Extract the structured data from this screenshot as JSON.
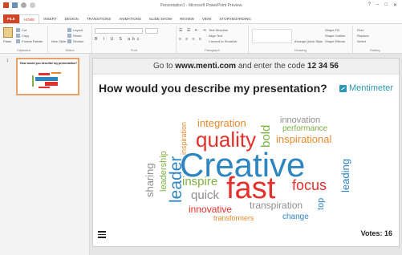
{
  "window": {
    "title": "Presentation1 - Microsoft PowerPoint Preview"
  },
  "tabs": [
    "FILE",
    "HOME",
    "INSERT",
    "DESIGN",
    "TRANSITIONS",
    "ANIMATIONS",
    "SLIDE SHOW",
    "REVIEW",
    "VIEW",
    "STORYBOARDING"
  ],
  "active_tab_index": 1,
  "ribbon": {
    "groups": [
      "Clipboard",
      "Slides",
      "Font",
      "Paragraph",
      "Drawing",
      "Editing"
    ],
    "clipboard": {
      "paste": "Paste",
      "cut": "Cut",
      "copy": "Copy",
      "format_painter": "Format Painter"
    },
    "slides": {
      "new_slide": "New Slide",
      "layout": "Layout",
      "reset": "Reset",
      "section": "Section"
    },
    "drawing": {
      "arrange": "Arrange",
      "quick_styles": "Quick Styles",
      "shape_fill": "Shape Fill",
      "shape_outline": "Shape Outline",
      "shape_effects": "Shape Effects"
    },
    "editing": {
      "find": "Find",
      "replace": "Replace",
      "select": "Select"
    },
    "paragraph": {
      "text_direction": "Text Direction",
      "align_text": "Align Text",
      "smartart": "Convert to SmartArt"
    }
  },
  "thumbnail": {
    "number": "1",
    "title": "How would you describe my presentation?"
  },
  "slide": {
    "header_prefix": "Go to",
    "header_site": "www.menti.com",
    "header_mid": "and enter the code",
    "header_code": "12 34 56",
    "question": "How would you describe my presentation?",
    "brand": "Mentimeter",
    "votes": "Votes: 16"
  },
  "colors": {
    "file_tab": "#d04525",
    "brand": "#2b97b4",
    "word_blue": "#2e86c1",
    "word_red": "#e5302c",
    "word_orange": "#e8892b",
    "word_green": "#7cb342",
    "word_gray": "#8f8f8f",
    "word_dark_gray": "#666666"
  },
  "word_cloud": [
    {
      "text": "Creative",
      "color": "#2e86c1"
    },
    {
      "text": "fast",
      "color": "#e5302c"
    },
    {
      "text": "quality",
      "color": "#e5302c"
    },
    {
      "text": "focus",
      "color": "#e5302c"
    },
    {
      "text": "leader",
      "color": "#2e86c1"
    },
    {
      "text": "integration",
      "color": "#e8892b"
    },
    {
      "text": "innovation",
      "color": "#8f8f8f"
    },
    {
      "text": "performance",
      "color": "#7cb342"
    },
    {
      "text": "inspirational",
      "color": "#e8892b"
    },
    {
      "text": "bold",
      "color": "#7cb342"
    },
    {
      "text": "inspiration",
      "color": "#e8892b"
    },
    {
      "text": "leadership",
      "color": "#7cb342"
    },
    {
      "text": "sharing",
      "color": "#8f8f8f"
    },
    {
      "text": "inspire",
      "color": "#7cb342"
    },
    {
      "text": "quick",
      "color": "#8f8f8f"
    },
    {
      "text": "innovative",
      "color": "#e5302c"
    },
    {
      "text": "transpiration",
      "color": "#8f8f8f"
    },
    {
      "text": "transformers",
      "color": "#e8892b"
    },
    {
      "text": "change",
      "color": "#2e86c1"
    },
    {
      "text": "top",
      "color": "#2e86c1"
    },
    {
      "text": "leading",
      "color": "#2e86c1"
    }
  ]
}
